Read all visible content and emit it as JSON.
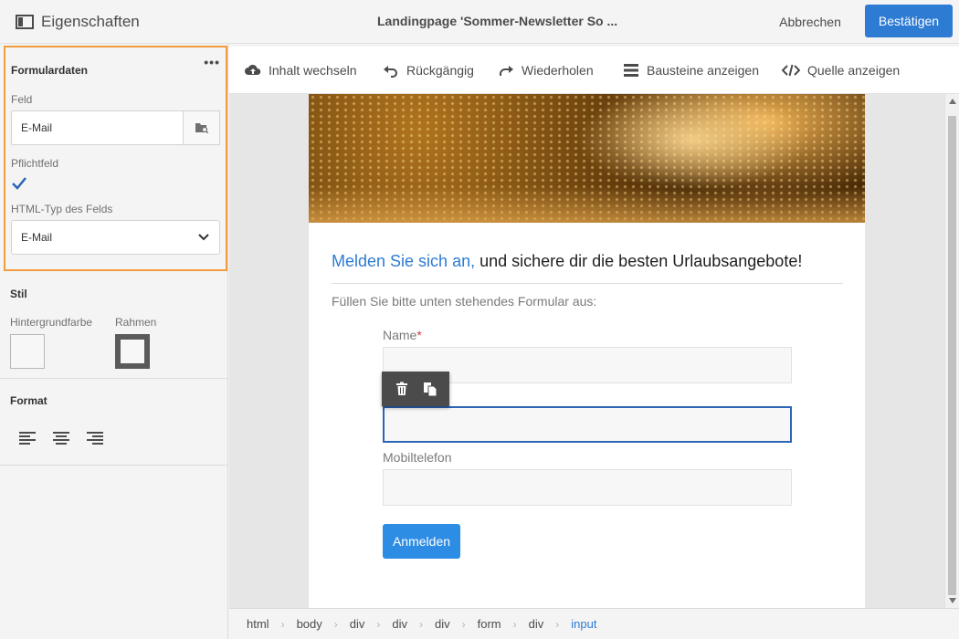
{
  "topbar": {
    "panel_title": "Eigenschaften",
    "document_title": "Landingpage 'Sommer-Newsletter So ...",
    "cancel_label": "Abbrechen",
    "confirm_label": "Bestätigen"
  },
  "properties": {
    "form_data": {
      "heading": "Formulardaten",
      "field_label": "Feld",
      "field_value": "E-Mail",
      "required_label": "Pflichtfeld",
      "required_checked": true,
      "html_type_label": "HTML-Typ des Felds",
      "html_type_value": "E-Mail"
    },
    "style": {
      "heading": "Stil",
      "background_label": "Hintergrundfarbe",
      "border_label": "Rahmen"
    },
    "format": {
      "heading": "Format",
      "align_options": [
        "left",
        "center",
        "right"
      ]
    }
  },
  "toolbar": {
    "items": [
      {
        "label": "Inhalt wechseln",
        "icon": "cloud-upload-icon"
      },
      {
        "label": "Rückgängig",
        "icon": "undo-icon"
      },
      {
        "label": "Wiederholen",
        "icon": "redo-icon"
      },
      {
        "label": "Bausteine anzeigen",
        "icon": "list-icon"
      },
      {
        "label": "Quelle anzeigen",
        "icon": "code-icon"
      }
    ]
  },
  "page": {
    "headline_accent": "Melden Sie sich an,",
    "headline_rest": " und sichere dir die besten Urlaubsangebote!",
    "intro": "Füllen Sie bitte unten stehendes Formular aus:",
    "fields": [
      {
        "label": "Name",
        "required_marker": "*"
      },
      {
        "label": "",
        "selected": true
      },
      {
        "label": "Mobiltelefon"
      }
    ],
    "submit_label": "Anmelden"
  },
  "breadcrumb": [
    "html",
    "body",
    "div",
    "div",
    "div",
    "form",
    "div",
    "input"
  ],
  "colors": {
    "accent": "#2d7bd3",
    "highlight_border": "#f39c3e",
    "selected_field": "#2b65b5"
  }
}
